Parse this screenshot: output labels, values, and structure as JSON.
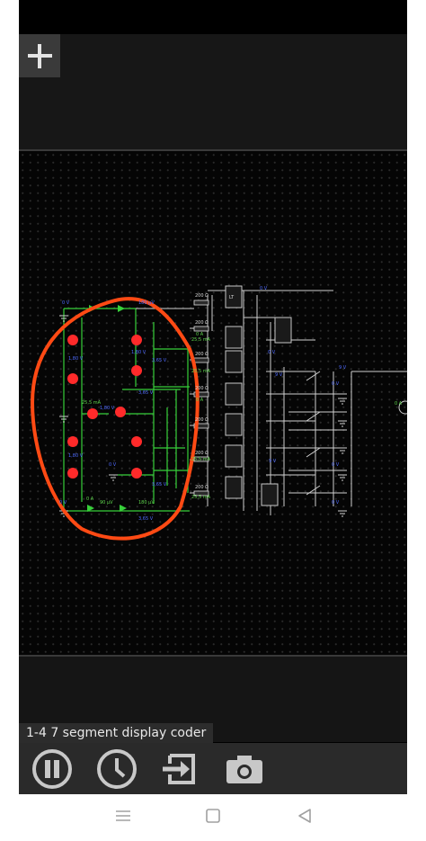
{
  "app": {
    "circuit_name": "1-4 7 segment display coder"
  },
  "toolbar": {
    "add_icon": "plus-icon"
  },
  "controls": {
    "pause_icon": "pause-icon",
    "speed_icon": "clock-icon",
    "import_icon": "import-icon",
    "screenshot_icon": "camera-icon"
  },
  "nav": {
    "menu_icon": "menu-icon",
    "home_icon": "square-icon",
    "back_icon": "back-triangle-icon"
  },
  "colors": {
    "wire": "#37d03a",
    "component": "#bdbdbd",
    "led_on": "#ff2020",
    "voltage_text": "#4f6bff",
    "current_text": "#5fd64d",
    "annotation": "#ff4a14",
    "background": "#050505"
  },
  "circuit": {
    "labels": {
      "v_top": "0 V",
      "uv_top": "180 μV",
      "v_365a": "3,65 V",
      "v_365b": "3,65 V",
      "v_365c": "3,65 V",
      "v_365d": "3,65 V",
      "v_180l": "1,80 V",
      "v_180m": "1,80 V",
      "v_180r": "1,80 V",
      "v_180lr": "1,80 V",
      "ma_a": "25,5 mA",
      "ma_b": "25,5 mA",
      "ma_c": "25,5 mA",
      "ma_d": "25,5 mA",
      "ma_e": "25,5 mA",
      "ohm_a": "200 Ω",
      "ohm_b": "200 Ω",
      "ohm_c": "200 Ω",
      "ohm_d": "200 Ω",
      "ohm_e": "200 Ω",
      "ohm_f": "200 Ω",
      "ohm_g": "200 Ω",
      "a0": "0 A",
      "a0b": "0 A",
      "a0c": "0 A",
      "a0d": "0 A",
      "v0a": "0 V",
      "v0b": "0 V",
      "v0c": "0 V",
      "v0d": "0 V",
      "v0e": "0 V",
      "v0f": "0 V",
      "v0g": "0 V",
      "v9a": "9 V",
      "v9b": "9 V",
      "v9c": "9 V",
      "uv_bottom": "90 μV",
      "uv_bottom2": "180 μV",
      "gate": "LT"
    }
  }
}
